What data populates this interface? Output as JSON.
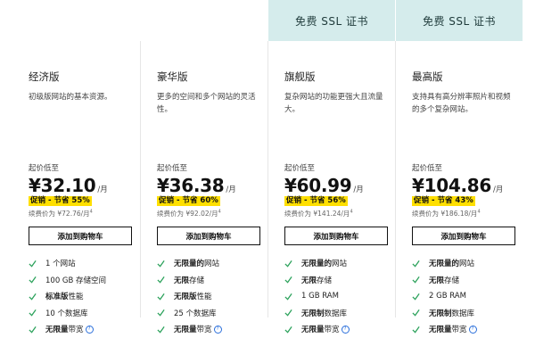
{
  "colors": {
    "banner_bg": "#d5ecec",
    "promo_badge": "#ffdf00",
    "check": "#2aa15a",
    "info": "#2a6fdb"
  },
  "plans": [
    {
      "banner": "",
      "name": "经济版",
      "desc": "初级版网站的基本资源。",
      "price_from": "起价低至",
      "price": "¥32.10",
      "per": "/月",
      "promo": "促销 - 节省 55%",
      "renew": "续费价为 ¥72.76/月",
      "renew_sup": "4",
      "cart": "添加到购物车",
      "features": [
        {
          "strong": "",
          "text": "1 个网站"
        },
        {
          "strong": "",
          "text": "100 GB 存储空间"
        },
        {
          "strong": "标准版",
          "text": "性能"
        },
        {
          "strong": "",
          "text": "10 个数据库"
        },
        {
          "strong": "无限量",
          "text": "带宽",
          "info": true
        }
      ]
    },
    {
      "banner": "",
      "name": "豪华版",
      "desc": "更多的空间和多个网站的灵活性。",
      "price_from": "起价低至",
      "price": "¥36.38",
      "per": "/月",
      "promo": "促销 - 节省 60%",
      "renew": "续费价为 ¥92.02/月",
      "renew_sup": "4",
      "cart": "添加到购物车",
      "features": [
        {
          "strong": "无限量的",
          "text": "网站"
        },
        {
          "strong": "无限",
          "text": "存储"
        },
        {
          "strong": "无限版",
          "text": "性能"
        },
        {
          "strong": "",
          "text": "25 个数据库"
        },
        {
          "strong": "无限量",
          "text": "带宽",
          "info": true
        }
      ]
    },
    {
      "banner": "免费 SSL 证书",
      "name": "旗舰版",
      "desc": "复杂网站的功能更强大且流量大。",
      "price_from": "起价低至",
      "price": "¥60.99",
      "per": "/月",
      "promo": "促销 - 节省 56%",
      "renew": "续费价为 ¥141.24/月",
      "renew_sup": "4",
      "cart": "添加到购物车",
      "features": [
        {
          "strong": "无限量的",
          "text": "网站"
        },
        {
          "strong": "无限",
          "text": "存储"
        },
        {
          "strong": "",
          "text": "1 GB RAM"
        },
        {
          "strong": "无限制",
          "text": "数据库"
        },
        {
          "strong": "无限量",
          "text": "带宽",
          "info": true
        }
      ]
    },
    {
      "banner": "免费 SSL 证书",
      "name": "最高版",
      "desc": "支持具有高分辨率照片和视频的多个复杂网站。",
      "price_from": "起价低至",
      "price": "¥104.86",
      "per": "/月",
      "promo": "促销 - 节省 43%",
      "renew": "续费价为 ¥186.18/月",
      "renew_sup": "4",
      "cart": "添加到购物车",
      "features": [
        {
          "strong": "无限量的",
          "text": "网站"
        },
        {
          "strong": "无限",
          "text": "存储"
        },
        {
          "strong": "",
          "text": "2 GB RAM"
        },
        {
          "strong": "无限制",
          "text": "数据库"
        },
        {
          "strong": "无限量",
          "text": "带宽",
          "info": true
        }
      ]
    }
  ]
}
